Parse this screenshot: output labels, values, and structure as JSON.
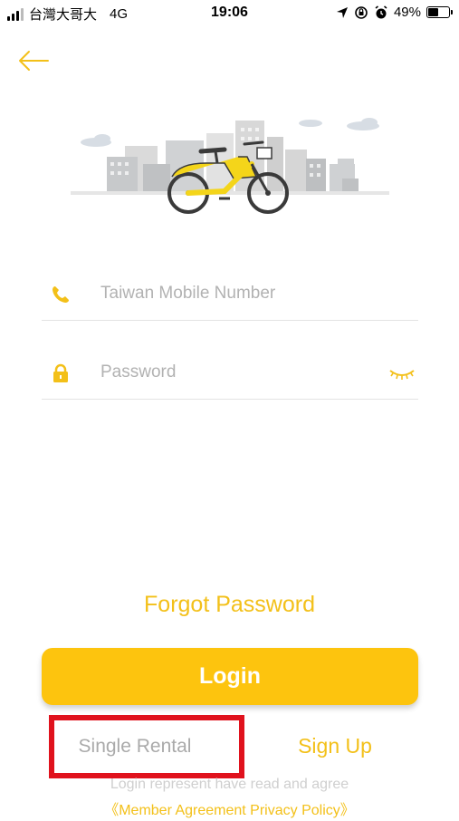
{
  "status_bar": {
    "carrier": "台灣大哥大",
    "network": "4G",
    "time": "19:06",
    "battery": "49%",
    "battery_level": 0.49
  },
  "icons": {
    "back": "arrow-left-icon",
    "phone": "phone-icon",
    "lock": "lock-icon",
    "eye": "eye-closed-icon"
  },
  "form": {
    "phone_placeholder": "Taiwan Mobile Number",
    "password_placeholder": "Password"
  },
  "actions": {
    "forgot_password": "Forgot Password",
    "login": "Login",
    "single_rental": "Single Rental",
    "sign_up": "Sign Up"
  },
  "footer": {
    "agree_text": "Login represent have read and agree",
    "agreement_links": "《Member Agreement Privacy Policy》"
  },
  "colors": {
    "accent": "#fdc40e",
    "accent_text": "#f3c019",
    "placeholder": "#b2b2b2",
    "highlight_box": "#e0121d"
  }
}
